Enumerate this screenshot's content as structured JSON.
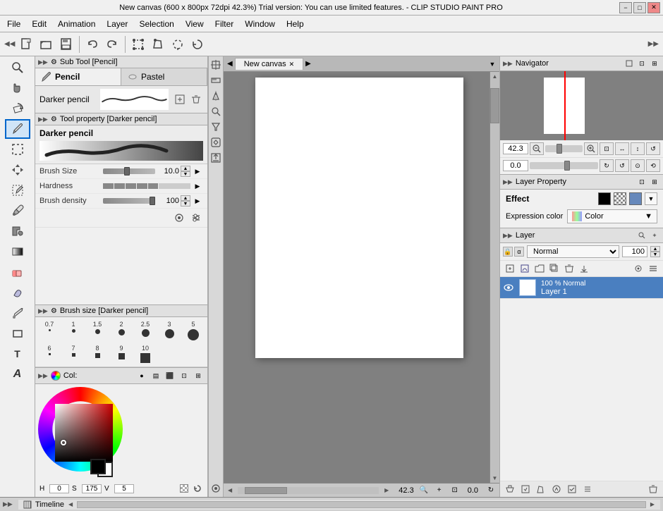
{
  "titleBar": {
    "text": "New canvas (600 x 800px 72dpi 42.3%)  Trial version: You can use limited features. - CLIP STUDIO PAINT PRO",
    "minimize": "−",
    "maximize": "□",
    "close": "✕"
  },
  "menuBar": {
    "items": [
      "File",
      "Edit",
      "Animation",
      "Layer",
      "Selection",
      "View",
      "Filter",
      "Window",
      "Help"
    ]
  },
  "toolbar": {
    "buttons": [
      "new",
      "open",
      "save",
      "undo",
      "redo",
      "transform",
      "deform",
      "lasso",
      "rotate"
    ],
    "collapse_left": "◀◀",
    "collapse_right": "▶▶"
  },
  "subToolPanel": {
    "header": "Sub Tool [Pencil]",
    "tabs": [
      {
        "label": "Pencil",
        "active": true
      },
      {
        "label": "Pastel",
        "active": false
      }
    ],
    "selectedBrush": "Darker pencil"
  },
  "toolProperty": {
    "header": "Tool property [Darker pencil]",
    "brushName": "Darker pencil",
    "properties": [
      {
        "label": "Brush Size",
        "value": "10.0"
      },
      {
        "label": "Hardness",
        "value": ""
      },
      {
        "label": "Brush density",
        "value": "100"
      }
    ]
  },
  "brushSize": {
    "header": "Brush size [Darker pencil]",
    "sizes": [
      {
        "label": "0.7",
        "dotSize": 3
      },
      {
        "label": "1",
        "dotSize": 5
      },
      {
        "label": "1.5",
        "dotSize": 7
      },
      {
        "label": "2",
        "dotSize": 9
      },
      {
        "label": "2.5",
        "dotSize": 11
      },
      {
        "label": "3",
        "dotSize": 13
      },
      {
        "label": "5",
        "dotSize": 16
      },
      {
        "label": "6",
        "dotSize": 18
      },
      {
        "label": "7",
        "dotSize": 20
      },
      {
        "label": "8",
        "dotSize": 22
      },
      {
        "label": "10",
        "dotSize": 25
      },
      {
        "label": "10",
        "dotSize": 28
      }
    ]
  },
  "colorPanel": {
    "header": "Col:",
    "hue": 0,
    "saturation": 175,
    "value": 5,
    "hsvValues": {
      "h": "0",
      "s": "175",
      "v": "5"
    },
    "colorWheelIcon": "●"
  },
  "canvas": {
    "tabLabel": "New canvas",
    "zoom": "42.3",
    "coordinates": "0.0",
    "scrollH": "42.3",
    "coordsDisplay": "0.0"
  },
  "navigator": {
    "header": "Navigator",
    "zoom": "42.3",
    "angle": "0.0"
  },
  "layerProperty": {
    "header": "Layer Property",
    "effect": "Effect",
    "expressionColor": "Expression color",
    "colorLabel": "Color",
    "swatches": [
      "black",
      "pattern",
      "blue"
    ]
  },
  "layerPanel": {
    "header": "Layer",
    "blendMode": "Normal",
    "opacity": "100",
    "layers": [
      {
        "name": "Layer 1",
        "visible": true,
        "percent": "100 %",
        "blendMode": "Normal",
        "selected": true
      }
    ]
  },
  "bottomBar": {
    "timelineLabel": "Timeline"
  },
  "icons": {
    "eye": "👁",
    "pencil": "✏",
    "move": "✥",
    "select": "⬚",
    "lasso": "⭕",
    "crop": "⊡",
    "eyedropper": "⊙",
    "fill": "▣",
    "eraser": "◻",
    "pen": "🖊",
    "brush": "🖌",
    "airbrush": "💨",
    "blend": "☁",
    "text": "T",
    "zoomIn": "+",
    "zoomOut": "−",
    "hand": "✋",
    "rotate_canvas": "↻",
    "search_plus": "🔍",
    "search_minus": "🔍"
  }
}
